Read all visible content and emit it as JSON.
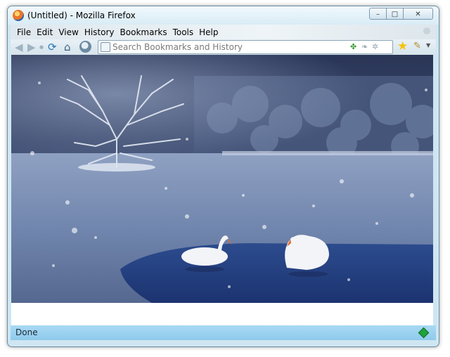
{
  "window": {
    "title": "(Untitled) - Mozilla Firefox",
    "controls": {
      "minimize": "–",
      "maximize": "□",
      "close": "✕"
    }
  },
  "menu": [
    {
      "label": "File"
    },
    {
      "label": "Edit"
    },
    {
      "label": "View"
    },
    {
      "label": "History"
    },
    {
      "label": "Bookmarks"
    },
    {
      "label": "Tools"
    },
    {
      "label": "Help"
    }
  ],
  "navbar": {
    "back_icon": "◀",
    "forward_icon": "▶",
    "reload_icon": "⟳",
    "home_icon": "⌂",
    "search_placeholder": "Search Bookmarks and History",
    "search_value": ""
  },
  "content": {
    "image_alt": "Two white swans on a snowy lake with a frosted tree"
  },
  "status": {
    "text": "Done"
  },
  "colors": {
    "status_bar": "#8fcaec",
    "title_bar": "#dff0f8",
    "scene_dark": "#2c3a5a",
    "water": "#7b8fb4"
  }
}
